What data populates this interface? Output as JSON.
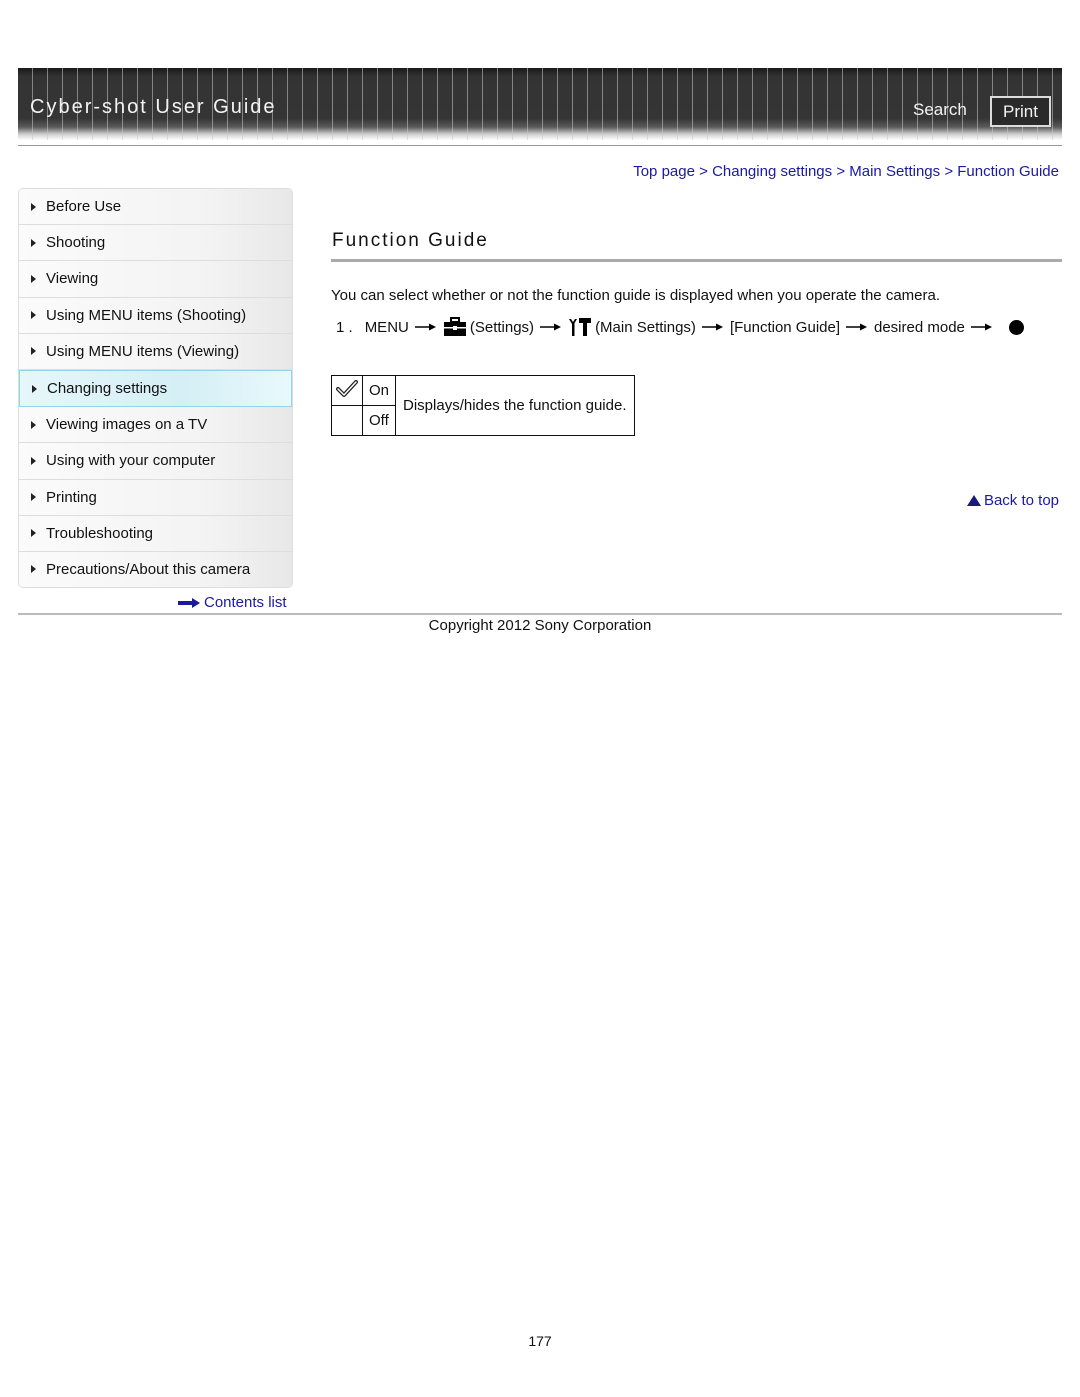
{
  "header": {
    "title": "Cyber-shot User Guide",
    "search_label": "Search",
    "print_label": "Print"
  },
  "breadcrumb": {
    "items": [
      "Top page",
      "Changing settings",
      "Main Settings",
      "Function Guide"
    ],
    "separator": ">"
  },
  "sidebar": {
    "items": [
      {
        "label": "Before Use"
      },
      {
        "label": "Shooting"
      },
      {
        "label": "Viewing"
      },
      {
        "label": "Using MENU items (Shooting)"
      },
      {
        "label": "Using MENU items (Viewing)"
      },
      {
        "label": "Changing settings",
        "active": true
      },
      {
        "label": "Viewing images on a TV"
      },
      {
        "label": "Using with your computer"
      },
      {
        "label": "Printing"
      },
      {
        "label": "Troubleshooting"
      },
      {
        "label": "Precautions/About this camera"
      }
    ],
    "contents_link": "Contents list"
  },
  "main": {
    "title": "Function Guide",
    "intro": "You can select whether or not the function guide is displayed when you operate the camera.",
    "step": {
      "number": "1 .",
      "menu": "MENU",
      "settings": "(Settings)",
      "main_settings": "(Main Settings)",
      "function_guide": "[Function Guide]",
      "desired_mode": "desired mode",
      "icons": [
        "arrow-right-icon",
        "toolbox-icon",
        "wrench-hammer-icon",
        "filled-circle-icon"
      ]
    },
    "options_table": {
      "rows": [
        {
          "icon": "checkmark-icon",
          "label": "On"
        },
        {
          "icon": "",
          "label": "Off"
        }
      ],
      "description": "Displays/hides the function guide."
    },
    "back_to_top": "Back to top"
  },
  "footer": {
    "copyright": "Copyright 2012 Sony Corporation",
    "page_number": "177"
  },
  "colors": {
    "link": "#1a1aa0",
    "header_bg": "#333333",
    "active_nav_bg": "#d4eff5"
  }
}
